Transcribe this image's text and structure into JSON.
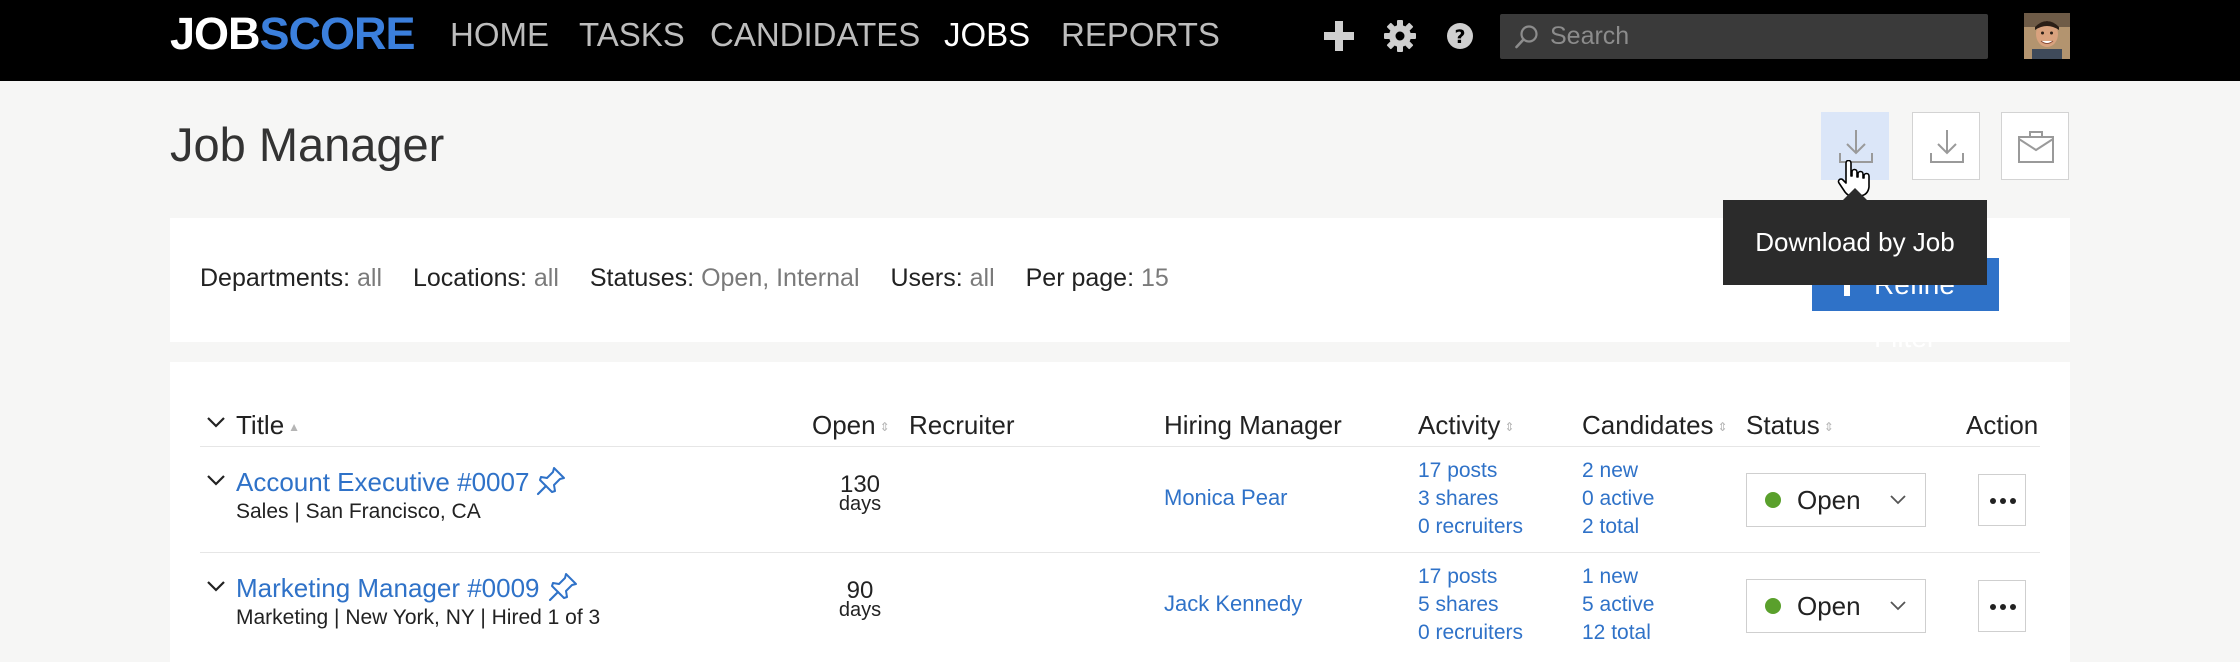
{
  "brand": {
    "logo_part1": "JOB",
    "logo_part2": "SCORE"
  },
  "nav": [
    "HOME",
    "TASKS",
    "CANDIDATES",
    "JOBS",
    "REPORTS"
  ],
  "nav_active": "JOBS",
  "search": {
    "placeholder": "Search",
    "value": ""
  },
  "page": {
    "title": "Job Manager"
  },
  "tooltip": "Download by Job",
  "filters": [
    {
      "label": "Departments:",
      "value": "all"
    },
    {
      "label": "Locations:",
      "value": "all"
    },
    {
      "label": "Statuses:",
      "value": "Open, Internal"
    },
    {
      "label": "Users:",
      "value": "all"
    },
    {
      "label": "Per page:",
      "value": "15"
    }
  ],
  "refine_label": "Refine Filter",
  "table": {
    "headers": {
      "title": "Title",
      "open": "Open",
      "recruiter": "Recruiter",
      "hiring_manager": "Hiring Manager",
      "activity": "Activity",
      "candidates": "Candidates",
      "status": "Status",
      "action": "Action"
    },
    "rows": [
      {
        "title": "Account Executive #0007",
        "subtitle": "Sales | San Francisco, CA",
        "open_value": "130",
        "open_unit": "days",
        "recruiter": "",
        "hiring_manager": "Monica Pear",
        "activity": [
          "17 posts",
          "3 shares",
          "0 recruiters"
        ],
        "candidates": [
          "2 new",
          "0 active",
          "2 total"
        ],
        "status": "Open"
      },
      {
        "title": "Marketing Manager #0009",
        "subtitle": "Marketing | New York, NY | Hired 1 of 3",
        "open_value": "90",
        "open_unit": "days",
        "recruiter": "",
        "hiring_manager": "Jack Kennedy",
        "activity": [
          "17 posts",
          "5 shares",
          "0 recruiters"
        ],
        "candidates": [
          "1 new",
          "5 active",
          "12 total"
        ],
        "status": "Open"
      }
    ]
  },
  "colors": {
    "link": "#2f72c8",
    "status_open": "#5aa02c",
    "topbar": "#000000",
    "hover": "#dbe6f8"
  }
}
